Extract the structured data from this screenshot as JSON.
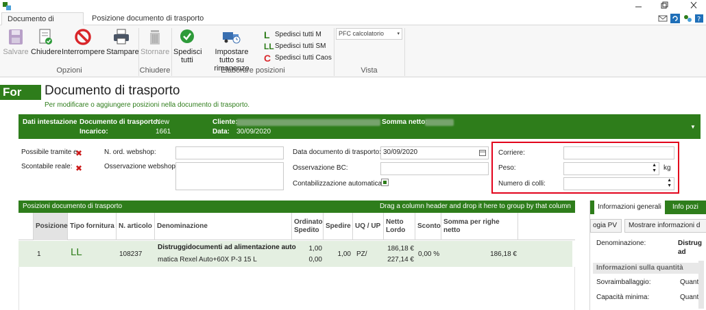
{
  "ribbon": {
    "tabs": [
      "Documento di trasporto",
      "Posizione documento di trasporto"
    ],
    "buttons": {
      "save": "Salvare",
      "close": "Chiudere",
      "stop": "Interrompere",
      "print": "Stampare",
      "cancel": "Stornare",
      "ship_all_1": "Spedisci",
      "ship_all_2": "tutti",
      "set_rest_1": "Impostare",
      "set_rest_2": "tutto su rimanenze"
    },
    "ship_list": [
      {
        "icon": "L",
        "label": "Spedisci tutti M"
      },
      {
        "icon": "LL",
        "label": "Spedisci tutti SM"
      },
      {
        "icon": "C",
        "label": "Spedisci tutti Caos"
      }
    ],
    "calculator_select": "PFC calcolatorio",
    "groups": [
      "Opzioni",
      "Chiudere",
      "Elaborare posizioni",
      "Vista"
    ]
  },
  "heading": {
    "badge": "For",
    "title": "Documento di trasporto",
    "subtitle": "Per modificare o aggiungere posizioni nella documento di trasporto."
  },
  "header_band": {
    "section": "Dati intestazione",
    "doc_label": "Documento di trasporto:",
    "doc_value": "New",
    "assign_label": "Incarico:",
    "assign_value": "1661",
    "customer_label": "Cliente:",
    "date_label": "Data:",
    "date_value": "30/09/2020",
    "net_label": "Somma netto:"
  },
  "form": {
    "possible_via": "Possibile tramite e",
    "real_accountable": "Scontabile reale:",
    "order_webshop": "N. ord. webshop:",
    "obs_webshop": "Osservazione webshop:",
    "doc_date_label": "Data documento di trasporto:",
    "doc_date_value": "30/09/2020",
    "obs_bc": "Osservazione BC:",
    "auto_accounting": "Contabilizzazione automatica",
    "carrier": "Corriere:",
    "weight": "Peso:",
    "weight_unit": "kg",
    "packages": "Numero di colli:"
  },
  "grid": {
    "title": "Posizioni documento di trasporto",
    "group_hint": "Drag a column header and drop it here to group by that column",
    "columns": [
      "Posizione",
      "Tipo fornitura",
      "N. articolo",
      "Denominazione",
      "Ordinato Spedito",
      "Spedire",
      "UQ / UP",
      "Netto Lordo",
      "Sconto",
      "Somma per righe netto"
    ],
    "row": {
      "pos": "1",
      "type": "LL",
      "article": "108237",
      "name_1": "Distruggidocumenti ad alimentazione auto",
      "name_2": "matica Rexel Auto+60X P-3 15 L",
      "ordered": "1,00",
      "shipped": "0,00",
      "to_ship": "1,00",
      "uq": "PZ/",
      "net": "186,18 €",
      "gross": "227,14 €",
      "discount": "0,00 %",
      "sum": "186,18 €"
    }
  },
  "right_panel": {
    "tabs": [
      "Informazioni generali",
      "Info pozi"
    ],
    "btn_1": "ogia PV",
    "btn_2": "Mostrare informazioni d",
    "name_label": "Denominazione:",
    "name_value_1": "Distrug",
    "name_value_2": "ad",
    "qty_header": "Informazioni sulla quantità",
    "over_pack": "Sovraimballaggio:",
    "over_pack_value": "Quanti",
    "min_capacity": "Capacità minima:",
    "min_capacity_value": "Quanti"
  }
}
